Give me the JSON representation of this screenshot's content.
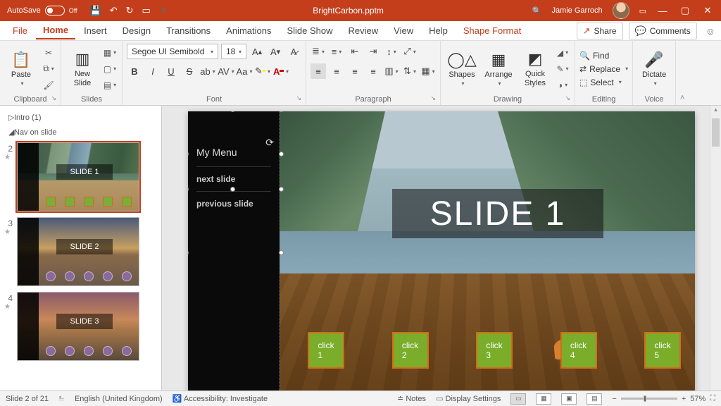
{
  "titlebar": {
    "autosave_label": "AutoSave",
    "autosave_state": "Off",
    "filename": "BrightCarbon.pptm",
    "user": "Jamie Garroch"
  },
  "tabs": {
    "file": "File",
    "items": [
      "Home",
      "Insert",
      "Design",
      "Transitions",
      "Animations",
      "Slide Show",
      "Review",
      "View",
      "Help"
    ],
    "context": "Shape Format",
    "active": "Home",
    "share": "Share",
    "comments": "Comments"
  },
  "ribbon": {
    "clipboard": {
      "label": "Clipboard",
      "paste": "Paste"
    },
    "slides": {
      "label": "Slides",
      "new_slide": "New\nSlide"
    },
    "font": {
      "label": "Font",
      "name": "Segoe UI Semibold",
      "size": "18"
    },
    "paragraph": {
      "label": "Paragraph"
    },
    "drawing": {
      "label": "Drawing",
      "shapes": "Shapes",
      "arrange": "Arrange",
      "quick_styles": "Quick\nStyles"
    },
    "editing": {
      "label": "Editing",
      "find": "Find",
      "replace": "Replace",
      "select": "Select"
    },
    "voice": {
      "label": "Voice",
      "dictate": "Dictate"
    }
  },
  "outline": {
    "sections": [
      {
        "expanded": false,
        "name": "Intro (1)"
      },
      {
        "expanded": true,
        "name": "Nav on slide"
      }
    ],
    "thumbs": [
      {
        "num": "2",
        "title": "SLIDE 1",
        "selected": true,
        "style": "fjord"
      },
      {
        "num": "3",
        "title": "SLIDE 2",
        "selected": false,
        "style": "sunset"
      },
      {
        "num": "4",
        "title": "SLIDE 3",
        "selected": false,
        "style": "arch"
      }
    ]
  },
  "slide": {
    "menu_title": "My Menu",
    "menu_items": [
      "next slide",
      "previous slide"
    ],
    "title": "SLIDE 1",
    "clicks": [
      "click\n1",
      "click\n2",
      "click\n3",
      "click\n4",
      "click\n5"
    ]
  },
  "statusbar": {
    "slide": "Slide 2 of 21",
    "lang": "English (United Kingdom)",
    "a11y": "Accessibility: Investigate",
    "notes": "Notes",
    "display": "Display Settings",
    "zoom": "57%"
  }
}
